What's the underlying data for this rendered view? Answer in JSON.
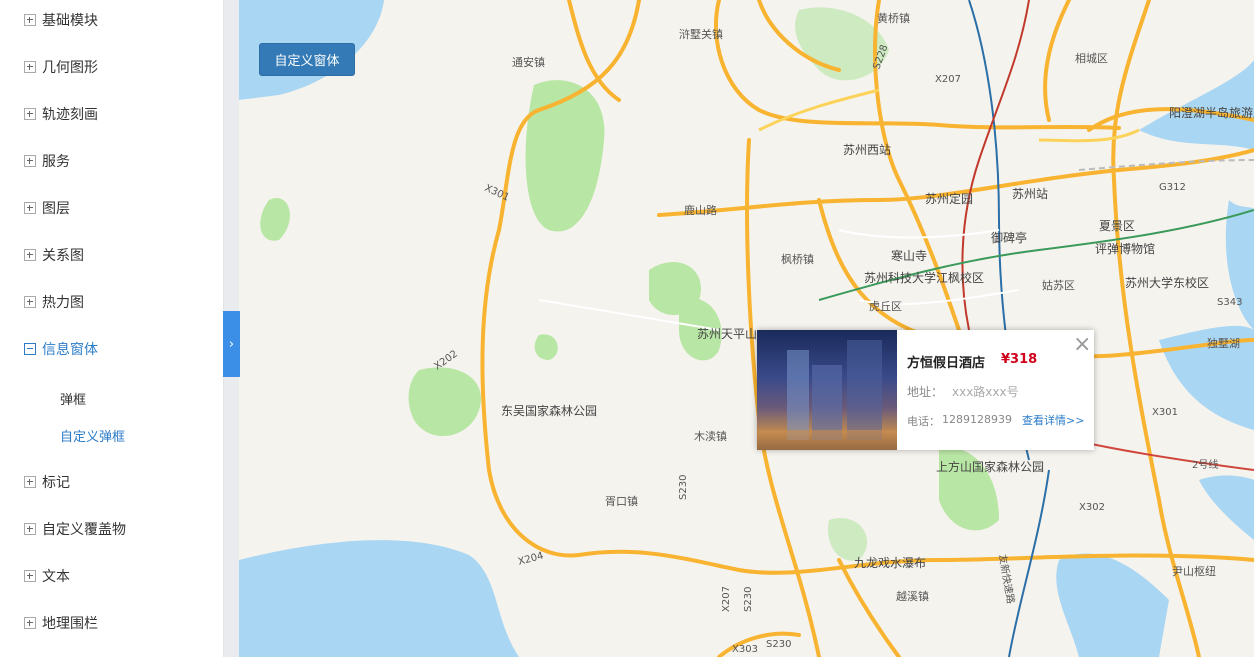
{
  "sidebar": {
    "items": [
      {
        "label": "基础模块",
        "state": "collapsed"
      },
      {
        "label": "几何图形",
        "state": "collapsed"
      },
      {
        "label": "轨迹刻画",
        "state": "collapsed"
      },
      {
        "label": "服务",
        "state": "collapsed"
      },
      {
        "label": "图层",
        "state": "collapsed"
      },
      {
        "label": "关系图",
        "state": "collapsed"
      },
      {
        "label": "热力图",
        "state": "collapsed"
      },
      {
        "label": "信息窗体",
        "state": "expanded"
      },
      {
        "label": "标记",
        "state": "collapsed"
      },
      {
        "label": "自定义覆盖物",
        "state": "collapsed"
      },
      {
        "label": "文本",
        "state": "collapsed"
      },
      {
        "label": "地理围栏",
        "state": "collapsed"
      }
    ],
    "subitems": [
      {
        "label": "弹框"
      },
      {
        "label": "自定义弹框"
      }
    ],
    "collapse_icon": "chevron-right-icon"
  },
  "toolbar": {
    "custom_window_label": "自定义窗体"
  },
  "popup": {
    "title": "方恒假日酒店",
    "price": "¥318",
    "address_label": "地址：",
    "address": "xxx路xxx号",
    "phone_label": "电话：",
    "phone": "1289128939",
    "detail_link": "查看详情>>",
    "close_icon": "close-icon"
  },
  "map": {
    "labels": {
      "l1": "浒墅关镇",
      "l2": "通安镇",
      "l3": "苏州西站",
      "l4": "苏州定园",
      "l5": "苏州站",
      "l6": "鹿山路",
      "l7": "枫桥镇",
      "l8": "寒山寺",
      "l9": "苏州科技大学江枫校区",
      "l10": "御碑亭",
      "l11": "夏景区",
      "l12": "评弹博物馆",
      "l13": "苏州大学东校区",
      "l14": "苏州天平山",
      "l15": "东吴国家森林公园",
      "l16": "木渎镇",
      "l17": "胥口镇",
      "l18": "上方山国家森林公园",
      "l19": "九龙戏水瀑布",
      "l20": "越溪镇",
      "l21": "尹山枢纽",
      "l22": "阳澄湖半岛旅游度",
      "l23": "相城区",
      "l24": "姑苏区",
      "l25": "虎丘区",
      "l26": "黄桥镇",
      "l27": "独墅湖",
      "r1": "X301",
      "r2": "X202",
      "r3": "X204",
      "r4": "S230",
      "r5": "X207",
      "r6": "S228",
      "r7": "X207",
      "r8": "G312",
      "r9": "S343",
      "r10": "X301",
      "r11": "X302",
      "r12": "X303",
      "r13": "S230",
      "r14": "S230",
      "r15": "友新快速路",
      "r16": "2号线"
    }
  }
}
